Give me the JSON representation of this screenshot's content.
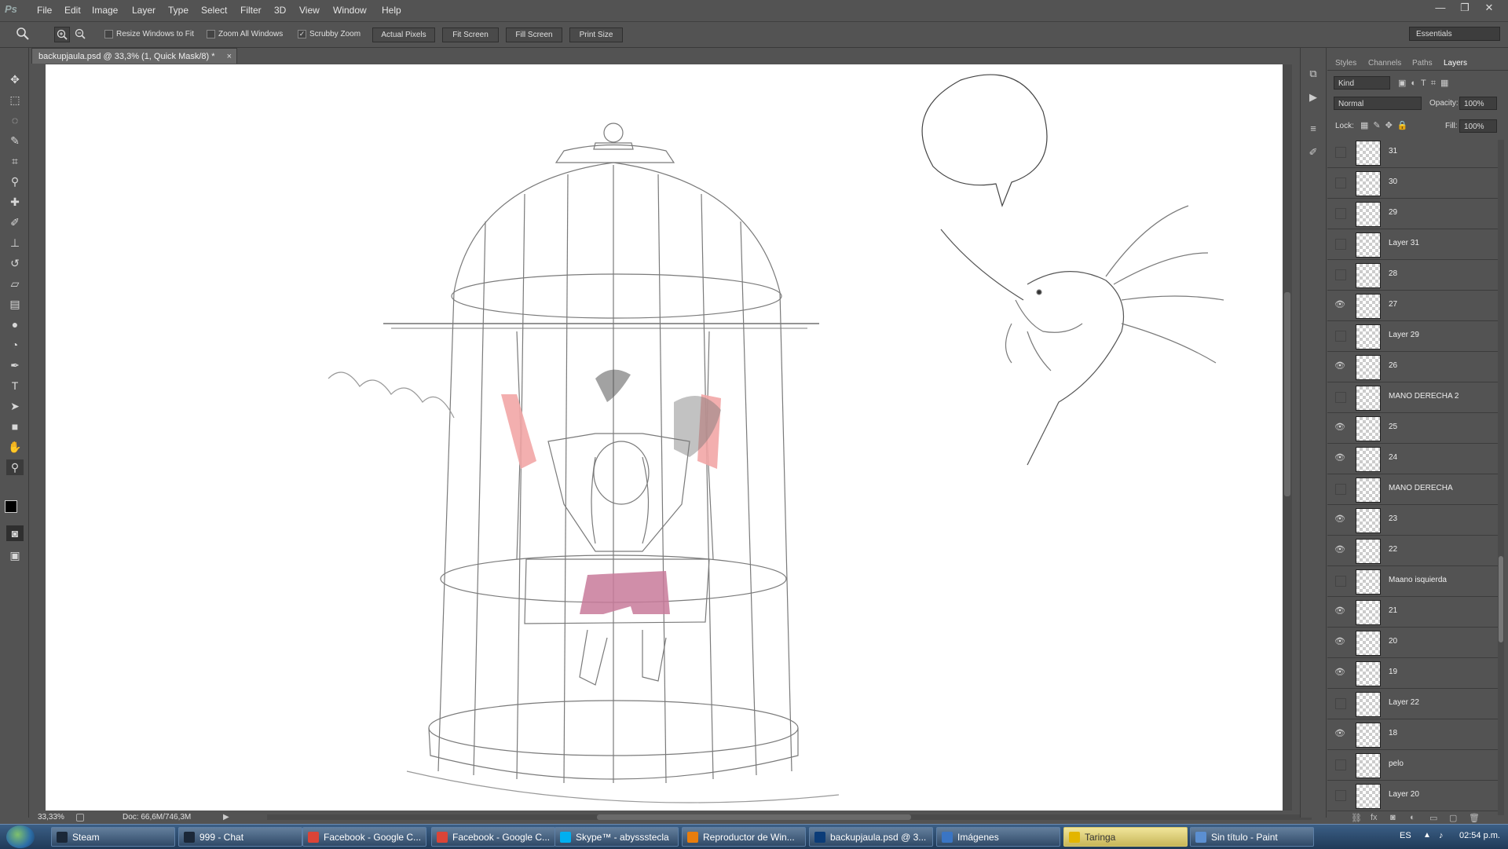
{
  "app": {
    "name": "Photoshop",
    "logo_text": "Ps"
  },
  "menu": [
    "File",
    "Edit",
    "Image",
    "Layer",
    "Type",
    "Select",
    "Filter",
    "3D",
    "View",
    "Window",
    "Help"
  ],
  "window_controls": {
    "minimize": "—",
    "restore": "❐",
    "close": "✕"
  },
  "options": {
    "resize_windows": "Resize Windows to Fit",
    "zoom_all_windows": "Zoom All Windows",
    "scrubby_zoom": "Scrubby Zoom",
    "scrubby_checked": "✓",
    "actual_pixels": "Actual Pixels",
    "fit_screen": "Fit Screen",
    "fill_screen": "Fill Screen",
    "print_size": "Print Size",
    "workspace": "Essentials"
  },
  "document": {
    "tab_title": "backupjaula.psd @ 33,3% (1, Quick Mask/8) *",
    "close": "×"
  },
  "status": {
    "zoom": "33,33%",
    "doc": "Doc: 66,6M/746,3M"
  },
  "panel": {
    "tabs": [
      "Styles",
      "Channels",
      "Paths",
      "Layers"
    ],
    "kind": "Kind",
    "blend_mode": "Normal",
    "opacity_label": "Opacity:",
    "opacity": "100%",
    "lock_label": "Lock:",
    "fill_label": "Fill:",
    "fill": "100%"
  },
  "layers": [
    {
      "name": "31",
      "visible": false
    },
    {
      "name": "30",
      "visible": false
    },
    {
      "name": "29",
      "visible": false
    },
    {
      "name": "Layer 31",
      "visible": false
    },
    {
      "name": "28",
      "visible": false
    },
    {
      "name": "27",
      "visible": true
    },
    {
      "name": "Layer 29",
      "visible": false
    },
    {
      "name": "26",
      "visible": true
    },
    {
      "name": "MANO DERECHA 2",
      "visible": false
    },
    {
      "name": "25",
      "visible": true
    },
    {
      "name": "24",
      "visible": true
    },
    {
      "name": "MANO DERECHA",
      "visible": false
    },
    {
      "name": "23",
      "visible": true
    },
    {
      "name": "22",
      "visible": true
    },
    {
      "name": "Maano isquierda",
      "visible": false
    },
    {
      "name": "21",
      "visible": true
    },
    {
      "name": "20",
      "visible": true
    },
    {
      "name": "19",
      "visible": true
    },
    {
      "name": "Layer 22",
      "visible": false
    },
    {
      "name": "18",
      "visible": true
    },
    {
      "name": "pelo",
      "visible": false
    },
    {
      "name": "Layer 20",
      "visible": false
    }
  ],
  "taskbar": [
    {
      "label": "Steam",
      "icon": "steam-icon",
      "color": "#1b2838"
    },
    {
      "label": "999 - Chat",
      "icon": "steam-chat-icon",
      "color": "#1b2838"
    },
    {
      "label": "Facebook - Google C...",
      "icon": "chrome-icon",
      "color": "#db4437"
    },
    {
      "label": "Facebook - Google C...",
      "icon": "chrome-icon",
      "color": "#db4437"
    },
    {
      "label": "Skype™ - abyssstecla",
      "icon": "skype-icon",
      "color": "#00aff0"
    },
    {
      "label": "Reproductor de Win...",
      "icon": "media-player-icon",
      "color": "#e87d0d"
    },
    {
      "label": "backupjaula.psd @ 3...",
      "icon": "photoshop-icon",
      "color": "#0b3c78"
    },
    {
      "label": "Imágenes",
      "icon": "folder-icon",
      "color": "#3a75c4"
    },
    {
      "label": "Taringa",
      "icon": "taringa-icon",
      "color": "#e3b500"
    },
    {
      "label": "Sin título - Paint",
      "icon": "paint-icon",
      "color": "#5b8fd1"
    }
  ],
  "tray": {
    "lang": "ES",
    "clock": "02:54 p.m."
  }
}
